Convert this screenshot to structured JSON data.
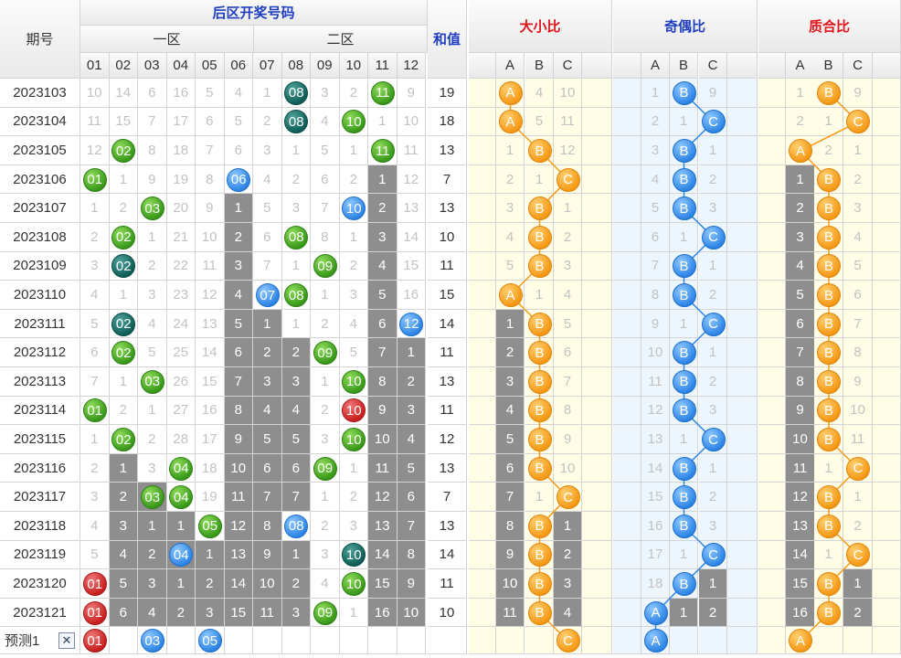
{
  "headers": {
    "period": "期号",
    "back_numbers": "后区开奖号码",
    "zone1": "一区",
    "zone2": "二区",
    "sum": "和值",
    "big_small": "大小比",
    "odd_even": "奇偶比",
    "prime_composite": "质合比",
    "numbers": [
      "01",
      "02",
      "03",
      "04",
      "05",
      "06",
      "07",
      "08",
      "09",
      "10",
      "11",
      "12"
    ],
    "abc": [
      "A",
      "B",
      "C"
    ]
  },
  "rows": [
    {
      "period": "2023103",
      "nums": [
        "10",
        "14",
        "6",
        "16",
        "5",
        "4",
        "1",
        "08",
        "3",
        "2",
        "11",
        "9"
      ],
      "sum": "19",
      "dx": [
        "A",
        "4",
        "10"
      ],
      "jo": [
        "1",
        "B",
        "9"
      ],
      "zh": [
        "1",
        "B",
        "9"
      ]
    },
    {
      "period": "2023104",
      "nums": [
        "11",
        "15",
        "7",
        "17",
        "6",
        "5",
        "2",
        "08",
        "4",
        "10",
        "1",
        "10"
      ],
      "sum": "18",
      "dx": [
        "A",
        "5",
        "11"
      ],
      "jo": [
        "2",
        "1",
        "C"
      ],
      "zh": [
        "2",
        "1",
        "C"
      ]
    },
    {
      "period": "2023105",
      "nums": [
        "12",
        "02",
        "8",
        "18",
        "7",
        "6",
        "3",
        "1",
        "5",
        "1",
        "11",
        "11"
      ],
      "sum": "13",
      "dx": [
        "1",
        "B",
        "12"
      ],
      "jo": [
        "3",
        "B",
        "1"
      ],
      "zh": [
        "A",
        "2",
        "1"
      ]
    },
    {
      "period": "2023106",
      "nums": [
        "01",
        "1",
        "9",
        "19",
        "8",
        "06",
        "4",
        "2",
        "6",
        "2",
        "1",
        "12"
      ],
      "sum": "7",
      "dx": [
        "2",
        "1",
        "C"
      ],
      "jo": [
        "4",
        "B",
        "2"
      ],
      "zh": [
        "1",
        "B",
        "2"
      ]
    },
    {
      "period": "2023107",
      "nums": [
        "1",
        "2",
        "03",
        "20",
        "9",
        "1",
        "5",
        "3",
        "7",
        "10",
        "2",
        "13"
      ],
      "sum": "13",
      "dx": [
        "3",
        "B",
        "1"
      ],
      "jo": [
        "5",
        "B",
        "3"
      ],
      "zh": [
        "2",
        "B",
        "3"
      ]
    },
    {
      "period": "2023108",
      "nums": [
        "2",
        "02",
        "1",
        "21",
        "10",
        "2",
        "6",
        "08",
        "8",
        "1",
        "3",
        "14"
      ],
      "sum": "10",
      "dx": [
        "4",
        "B",
        "2"
      ],
      "jo": [
        "6",
        "1",
        "C"
      ],
      "zh": [
        "3",
        "B",
        "4"
      ]
    },
    {
      "period": "2023109",
      "nums": [
        "3",
        "02",
        "2",
        "22",
        "11",
        "3",
        "7",
        "1",
        "09",
        "2",
        "4",
        "15"
      ],
      "sum": "11",
      "dx": [
        "5",
        "B",
        "3"
      ],
      "jo": [
        "7",
        "B",
        "1"
      ],
      "zh": [
        "4",
        "B",
        "5"
      ]
    },
    {
      "period": "2023110",
      "nums": [
        "4",
        "1",
        "3",
        "23",
        "12",
        "4",
        "07",
        "08",
        "1",
        "3",
        "5",
        "16"
      ],
      "sum": "15",
      "dx": [
        "A",
        "1",
        "4"
      ],
      "jo": [
        "8",
        "B",
        "2"
      ],
      "zh": [
        "5",
        "B",
        "6"
      ]
    },
    {
      "period": "2023111",
      "nums": [
        "5",
        "02",
        "4",
        "24",
        "13",
        "5",
        "1",
        "1",
        "2",
        "4",
        "6",
        "12"
      ],
      "sum": "14",
      "dx": [
        "1",
        "B",
        "5"
      ],
      "jo": [
        "9",
        "1",
        "C"
      ],
      "zh": [
        "6",
        "B",
        "7"
      ]
    },
    {
      "period": "2023112",
      "nums": [
        "6",
        "02",
        "5",
        "25",
        "14",
        "6",
        "2",
        "2",
        "09",
        "5",
        "7",
        "1"
      ],
      "sum": "11",
      "dx": [
        "2",
        "B",
        "6"
      ],
      "jo": [
        "10",
        "B",
        "1"
      ],
      "zh": [
        "7",
        "B",
        "8"
      ]
    },
    {
      "period": "2023113",
      "nums": [
        "7",
        "1",
        "03",
        "26",
        "15",
        "7",
        "3",
        "3",
        "1",
        "10",
        "8",
        "2"
      ],
      "sum": "13",
      "dx": [
        "3",
        "B",
        "7"
      ],
      "jo": [
        "11",
        "B",
        "2"
      ],
      "zh": [
        "8",
        "B",
        "9"
      ]
    },
    {
      "period": "2023114",
      "nums": [
        "01",
        "2",
        "1",
        "27",
        "16",
        "8",
        "4",
        "4",
        "2",
        "10",
        "9",
        "3"
      ],
      "sum": "11",
      "dx": [
        "4",
        "B",
        "8"
      ],
      "jo": [
        "12",
        "B",
        "3"
      ],
      "zh": [
        "9",
        "B",
        "10"
      ]
    },
    {
      "period": "2023115",
      "nums": [
        "1",
        "02",
        "2",
        "28",
        "17",
        "9",
        "5",
        "5",
        "3",
        "10",
        "10",
        "4"
      ],
      "sum": "12",
      "dx": [
        "5",
        "B",
        "9"
      ],
      "jo": [
        "13",
        "1",
        "C"
      ],
      "zh": [
        "10",
        "B",
        "11"
      ]
    },
    {
      "period": "2023116",
      "nums": [
        "2",
        "1",
        "3",
        "04",
        "18",
        "10",
        "6",
        "6",
        "09",
        "1",
        "11",
        "5"
      ],
      "sum": "13",
      "dx": [
        "6",
        "B",
        "10"
      ],
      "jo": [
        "14",
        "B",
        "1"
      ],
      "zh": [
        "11",
        "1",
        "C"
      ]
    },
    {
      "period": "2023117",
      "nums": [
        "3",
        "2",
        "03",
        "04",
        "19",
        "11",
        "7",
        "7",
        "1",
        "2",
        "12",
        "6"
      ],
      "sum": "7",
      "dx": [
        "7",
        "1",
        "C"
      ],
      "jo": [
        "15",
        "B",
        "2"
      ],
      "zh": [
        "12",
        "B",
        "1"
      ]
    },
    {
      "period": "2023118",
      "nums": [
        "4",
        "3",
        "1",
        "1",
        "05",
        "12",
        "8",
        "08",
        "2",
        "3",
        "13",
        "7"
      ],
      "sum": "13",
      "dx": [
        "8",
        "B",
        "1"
      ],
      "jo": [
        "16",
        "B",
        "3"
      ],
      "zh": [
        "13",
        "B",
        "2"
      ]
    },
    {
      "period": "2023119",
      "nums": [
        "5",
        "4",
        "2",
        "04",
        "1",
        "13",
        "9",
        "1",
        "3",
        "10",
        "14",
        "8"
      ],
      "sum": "14",
      "dx": [
        "9",
        "B",
        "2"
      ],
      "jo": [
        "17",
        "1",
        "C"
      ],
      "zh": [
        "14",
        "1",
        "C"
      ]
    },
    {
      "period": "2023120",
      "nums": [
        "01",
        "5",
        "3",
        "1",
        "2",
        "14",
        "10",
        "2",
        "4",
        "10",
        "15",
        "9"
      ],
      "sum": "11",
      "dx": [
        "10",
        "B",
        "3"
      ],
      "jo": [
        "18",
        "B",
        "1"
      ],
      "zh": [
        "15",
        "B",
        "1"
      ]
    },
    {
      "period": "2023121",
      "nums": [
        "01",
        "6",
        "4",
        "2",
        "3",
        "15",
        "11",
        "3",
        "09",
        "1",
        "16",
        "10"
      ],
      "sum": "10",
      "dx": [
        "11",
        "B",
        "4"
      ],
      "jo": [
        "A",
        "1",
        "2"
      ],
      "zh": [
        "16",
        "B",
        "2"
      ]
    }
  ],
  "predict": {
    "label": "预测1",
    "close": "✕",
    "nums": [
      "01",
      "",
      "03",
      "",
      "05",
      "",
      "",
      "",
      "",
      "",
      "",
      ""
    ],
    "dx": [
      "",
      "",
      "C"
    ],
    "jo": [
      "A",
      "",
      ""
    ],
    "zh": [
      "A",
      "",
      ""
    ]
  },
  "colors": {
    "green": "#3a9a1a",
    "teal": "#0f5f57",
    "blue": "#2f86e6",
    "red": "#c8201f",
    "orange": "#f59a16",
    "gray": "#8e8e8e",
    "header_blue": "#1f3fbf",
    "header_red": "#e0141b",
    "yellow_bg": "#fffde6",
    "blue_bg": "#eef6fd"
  },
  "styles": {
    "nums_ball": [
      {
        "r": 0,
        "c": 7,
        "k": "t"
      },
      {
        "r": 0,
        "c": 10,
        "k": "g"
      },
      {
        "r": 1,
        "c": 7,
        "k": "t"
      },
      {
        "r": 1,
        "c": 9,
        "k": "g"
      },
      {
        "r": 2,
        "c": 1,
        "k": "g"
      },
      {
        "r": 2,
        "c": 10,
        "k": "g"
      },
      {
        "r": 3,
        "c": 0,
        "k": "g"
      },
      {
        "r": 3,
        "c": 5,
        "k": "b"
      },
      {
        "r": 4,
        "c": 2,
        "k": "g"
      },
      {
        "r": 4,
        "c": 9,
        "k": "b"
      },
      {
        "r": 5,
        "c": 1,
        "k": "g"
      },
      {
        "r": 5,
        "c": 7,
        "k": "g"
      },
      {
        "r": 6,
        "c": 1,
        "k": "t"
      },
      {
        "r": 6,
        "c": 8,
        "k": "g"
      },
      {
        "r": 7,
        "c": 6,
        "k": "b"
      },
      {
        "r": 7,
        "c": 7,
        "k": "g"
      },
      {
        "r": 8,
        "c": 1,
        "k": "t"
      },
      {
        "r": 8,
        "c": 11,
        "k": "b"
      },
      {
        "r": 9,
        "c": 1,
        "k": "g"
      },
      {
        "r": 9,
        "c": 8,
        "k": "g"
      },
      {
        "r": 10,
        "c": 2,
        "k": "g"
      },
      {
        "r": 10,
        "c": 9,
        "k": "g"
      },
      {
        "r": 11,
        "c": 0,
        "k": "g"
      },
      {
        "r": 11,
        "c": 9,
        "k": "r"
      },
      {
        "r": 12,
        "c": 1,
        "k": "g"
      },
      {
        "r": 12,
        "c": 9,
        "k": "g"
      },
      {
        "r": 13,
        "c": 3,
        "k": "g"
      },
      {
        "r": 13,
        "c": 8,
        "k": "g"
      },
      {
        "r": 14,
        "c": 2,
        "k": "g"
      },
      {
        "r": 14,
        "c": 3,
        "k": "g"
      },
      {
        "r": 15,
        "c": 4,
        "k": "g"
      },
      {
        "r": 15,
        "c": 7,
        "k": "b"
      },
      {
        "r": 16,
        "c": 3,
        "k": "b"
      },
      {
        "r": 16,
        "c": 9,
        "k": "t"
      },
      {
        "r": 17,
        "c": 0,
        "k": "r"
      },
      {
        "r": 17,
        "c": 9,
        "k": "g"
      },
      {
        "r": 18,
        "c": 0,
        "k": "r"
      },
      {
        "r": 18,
        "c": 8,
        "k": "g"
      }
    ],
    "nums_gray": [
      "4:5",
      "5:5",
      "6:5",
      "7:5",
      "8:5",
      "9:5",
      "10:5",
      "11:5",
      "12:5",
      "13:5",
      "14:5",
      "15:5",
      "16:5",
      "17:5",
      "18:5",
      "8:6",
      "9:6",
      "10:6",
      "11:6",
      "12:6",
      "13:6",
      "14:6",
      "15:6",
      "16:6",
      "17:6",
      "18:6",
      "9:7",
      "10:7",
      "11:7",
      "12:7",
      "13:7",
      "14:7",
      "16:7",
      "17:7",
      "18:7",
      "3:10",
      "4:10",
      "5:10",
      "6:10",
      "7:10",
      "8:10",
      "9:10",
      "10:10",
      "11:10",
      "12:10",
      "13:10",
      "14:10",
      "15:10",
      "16:10",
      "17:10",
      "18:10",
      "9:11",
      "10:11",
      "11:11",
      "12:11",
      "13:11",
      "14:11",
      "15:11",
      "16:11",
      "17:11",
      "18:11",
      "13:1",
      "14:1",
      "15:1",
      "16:1",
      "17:1",
      "18:1",
      "14:2",
      "15:2",
      "16:2",
      "17:2",
      "18:2",
      "15:3",
      "16:3",
      "17:3",
      "18:3",
      "16:4",
      "17:4",
      "18:4"
    ]
  }
}
